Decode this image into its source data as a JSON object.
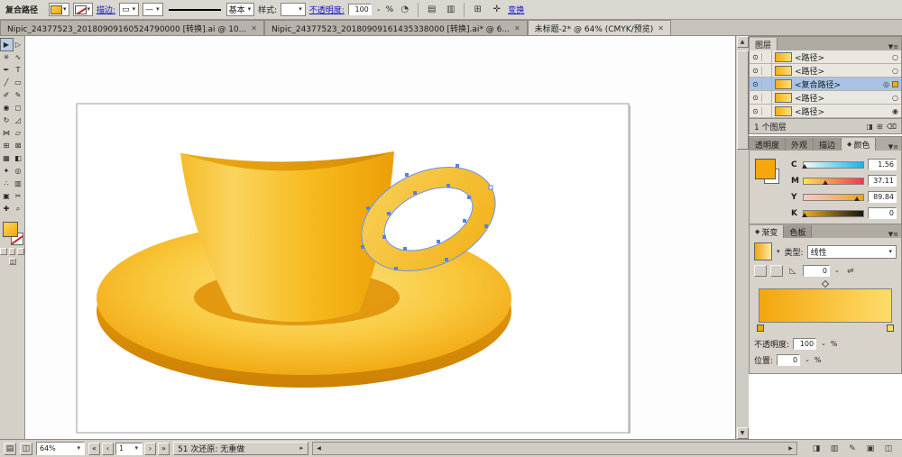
{
  "control_bar": {
    "context_label": "复合路径",
    "stroke_link": "描边:",
    "brush_value": "基本",
    "style_label": "样式:",
    "opacity_link": "不透明度:",
    "opacity_value": "100",
    "percent": "%",
    "transform_link": "变换"
  },
  "tabs": [
    {
      "title": "Nipic_24377523_20180909160524790000  [转换].ai @ 10..."
    },
    {
      "title": "Nipic_24377523_20180909161435338000  [转换].ai* @ 6..."
    },
    {
      "title": "未标题-2* @ 64% (CMYK/预览)"
    }
  ],
  "tools": [
    {
      "g": "▶"
    },
    {
      "g": "▷"
    },
    {
      "g": "✳"
    },
    {
      "g": "∿"
    },
    {
      "g": "✒"
    },
    {
      "g": "T"
    },
    {
      "g": "╱"
    },
    {
      "g": "▭"
    },
    {
      "g": "✐"
    },
    {
      "g": "✎"
    },
    {
      "g": "◉"
    },
    {
      "g": "◻"
    },
    {
      "g": "↻"
    },
    {
      "g": "◿"
    },
    {
      "g": "⋈"
    },
    {
      "g": "▱"
    },
    {
      "g": "⊞"
    },
    {
      "g": "⊠"
    },
    {
      "g": "▦"
    },
    {
      "g": "◧"
    },
    {
      "g": "✦"
    },
    {
      "g": "◎"
    },
    {
      "g": "∴"
    },
    {
      "g": "▥"
    },
    {
      "g": "▣"
    },
    {
      "g": "✂"
    },
    {
      "g": "✚"
    },
    {
      "g": "⌕"
    }
  ],
  "layers": {
    "title": "图层",
    "rows": [
      {
        "name": "<路径>"
      },
      {
        "name": "<路径>"
      },
      {
        "name": "<复合路径>"
      },
      {
        "name": "<路径>"
      },
      {
        "name": "<路径>"
      }
    ],
    "footer": "1 个图层"
  },
  "color_panel": {
    "tab_transparency": "透明度",
    "tab_appearance": "外观",
    "tab_stroke": "描边",
    "tab_color": "颜色",
    "sliders": [
      {
        "label": "C",
        "value": "1.56"
      },
      {
        "label": "M",
        "value": "37.11"
      },
      {
        "label": "Y",
        "value": "89.84"
      },
      {
        "label": "K",
        "value": "0"
      }
    ]
  },
  "gradient_panel": {
    "tab_gradient": "渐变",
    "tab_swatches": "色板",
    "type_label": "类型:",
    "type_value": "线性",
    "angle_value": "0",
    "opacity_label": "不透明度:",
    "opacity_value": "100",
    "position_label": "位置:",
    "position_value": "0",
    "percent": "%"
  },
  "status_bar": {
    "zoom": "64%",
    "page": "1",
    "undo_status": "51 次还原: 无重做"
  },
  "icons": {
    "dropdown": "▾",
    "spinner": "⌄",
    "close": "✕",
    "eye": "⊙",
    "target": "○",
    "target_selected": "◎",
    "target_filled": "◉",
    "panel_menu": "▼≡",
    "panel_bullet": "◆",
    "stroke_box": "▭",
    "profile": "—",
    "recolor": "◔",
    "align_a": "▤",
    "align_b": "▥",
    "grid": "⊞",
    "plus": "✛",
    "mask": "◨",
    "new_layer": "⊞",
    "delete": "⌫",
    "angle": "◺",
    "reverse": "⇌",
    "first": "«",
    "prev": "‹",
    "next": "›",
    "last": "»",
    "left": "◀",
    "right": "▶",
    "up": "▲",
    "down": "▼",
    "flyout": "▸",
    "screen_a": "▤",
    "screen_b": "◫",
    "dock1": "◨",
    "dock2": "▥",
    "dock3": "✎",
    "dock4": "▣",
    "dock5": "◫"
  },
  "colors": {
    "accent_yellow": "#f6a70e",
    "selection_blue": "#5583e3"
  }
}
